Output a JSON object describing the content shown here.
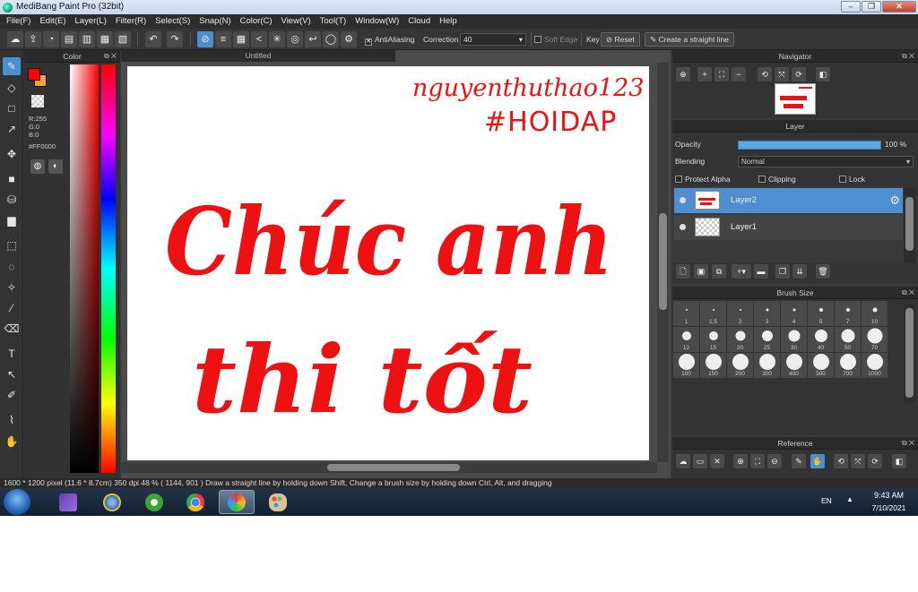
{
  "window": {
    "title": "MediBang Paint Pro (32bit)"
  },
  "menu": [
    "File(F)",
    "Edit(E)",
    "Layer(L)",
    "Filter(R)",
    "Select(S)",
    "Snap(N)",
    "Color(C)",
    "View(V)",
    "Tool(T)",
    "Window(W)",
    "Cloud",
    "Help"
  ],
  "toolbar": {
    "antialiasing": "AntiAliasing",
    "correction_label": "Correction",
    "correction_value": "40",
    "soft_edge": "Soft Edge",
    "key_label": "Key",
    "reset": "Reset",
    "straight_line": "Create a straight line"
  },
  "color_panel": {
    "title": "Color",
    "r": "R:255",
    "g": "G:0",
    "b": "B:0",
    "hex": "#FF0000",
    "fg_color": "#ff0000",
    "bg_color": "#f5a623"
  },
  "document": {
    "tab_title": "Untitled",
    "artwork": {
      "signature": "nguyenthuthao123",
      "hashtag": "#HOIDAP",
      "line1": "Chúc anh",
      "line2": "thi tốt",
      "ink_color": "#ee1111"
    }
  },
  "navigator": {
    "title": "Navigator"
  },
  "layer_panel": {
    "title": "Layer",
    "opacity_label": "Opacity",
    "opacity_value": "100 %",
    "opacity": 1.0,
    "blending_label": "Blending",
    "blending_value": "Normal",
    "protect_alpha": "Protect Alpha",
    "clipping": "Clipping",
    "lock": "Lock",
    "layers": [
      {
        "name": "Layer2",
        "selected": true
      },
      {
        "name": "Layer1",
        "selected": false
      }
    ]
  },
  "brush_size": {
    "title": "Brush Size",
    "sizes": [
      "1",
      "1.5",
      "2",
      "3",
      "4",
      "5",
      "7",
      "10",
      "12",
      "15",
      "20",
      "25",
      "30",
      "40",
      "50",
      "70",
      "100",
      "150",
      "200",
      "300",
      "400",
      "500",
      "700",
      "1000"
    ]
  },
  "reference": {
    "title": "Reference"
  },
  "status": {
    "text": "1600 * 1200 pixel   (11.6 * 8.7cm)   350 dpi   48 %   ( 1144, 901 )   Draw a straight line by holding down Shift, Change a brush size by holding down Ctrl, Alt, and dragging"
  },
  "taskbar": {
    "language": "EN",
    "time": "9:43 AM",
    "date": "7/10/2021"
  }
}
